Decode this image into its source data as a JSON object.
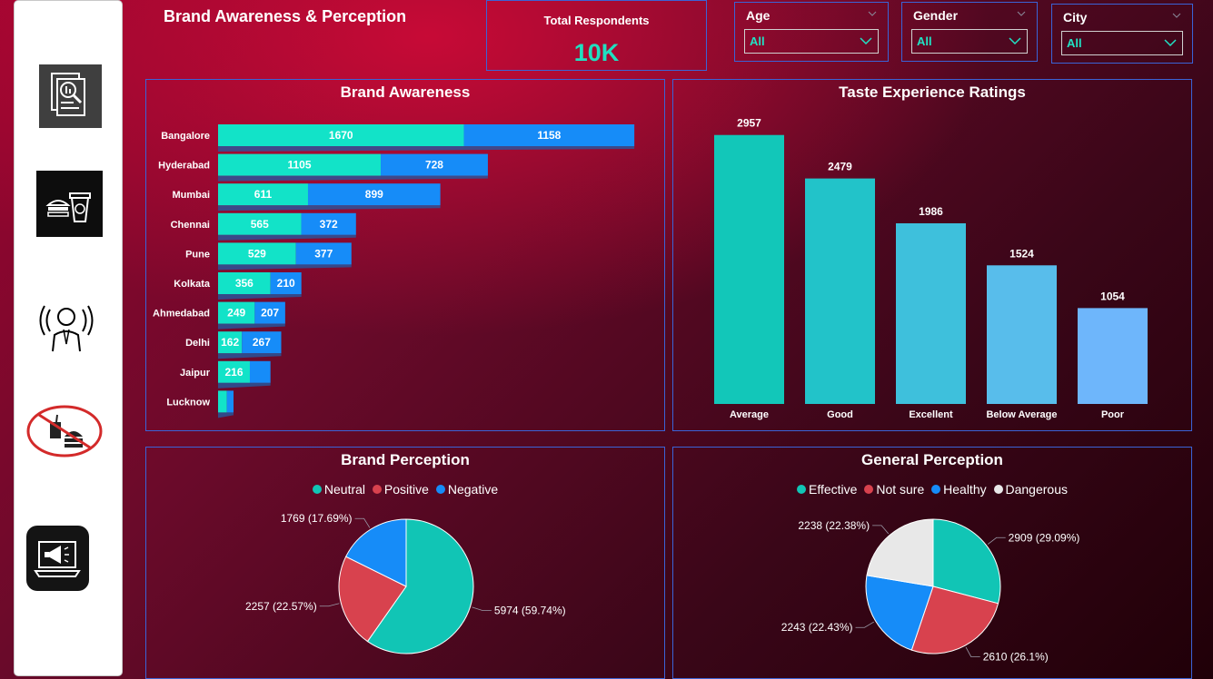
{
  "page_title": "Brand Awareness & Perception",
  "kpi": {
    "label": "Total Respondents",
    "value": "10K"
  },
  "slicers": [
    {
      "label": "Age",
      "value": "All"
    },
    {
      "label": "Gender",
      "value": "All"
    },
    {
      "label": "City",
      "value": "All"
    }
  ],
  "nav_icons": [
    "report-magnifier-icon",
    "food-drink-icon",
    "broadcast-person-icon",
    "no-fast-food-icon",
    "megaphone-laptop-icon"
  ],
  "colors": {
    "teal": "#12e3c8",
    "blue": "#168cf8",
    "neutral": "#11c5b5",
    "positive": "#d8424e",
    "negative": "#168cf8",
    "dangerous": "#e8e8e8",
    "accent_border": "#3b63d6"
  },
  "chart_data": [
    {
      "type": "bar",
      "orientation": "horizontal",
      "stacked": true,
      "title": "Brand Awareness",
      "categories": [
        "Bangalore",
        "Hyderabad",
        "Mumbai",
        "Chennai",
        "Pune",
        "Kolkata",
        "Ahmedabad",
        "Delhi",
        "Jaipur",
        "Lucknow"
      ],
      "series": [
        {
          "color": "#12e3c8",
          "values": [
            1670,
            1105,
            611,
            565,
            529,
            356,
            249,
            162,
            216,
            60
          ]
        },
        {
          "color": "#168cf8",
          "values": [
            1158,
            728,
            899,
            372,
            377,
            210,
            207,
            267,
            140,
            45
          ]
        }
      ],
      "data_labels": [
        [
          "1670",
          "1105",
          "611",
          "565",
          "529",
          "356",
          "249",
          "162",
          "216",
          ""
        ],
        [
          "1158",
          "728",
          "899",
          "372",
          "377",
          "210",
          "207",
          "267",
          "",
          ""
        ]
      ]
    },
    {
      "type": "bar",
      "title": "Taste Experience Ratings",
      "categories": [
        "Average",
        "Good",
        "Excellent",
        "Below Average",
        "Poor"
      ],
      "values": [
        2957,
        2479,
        1986,
        1524,
        1054
      ],
      "colors": [
        "#12c7b9",
        "#22c3c9",
        "#3ec0dc",
        "#58bdeb",
        "#6eb6fb"
      ]
    },
    {
      "type": "pie",
      "title": "Brand Perception",
      "legend": [
        "Neutral",
        "Positive",
        "Negative"
      ],
      "slices": [
        {
          "label": "Neutral",
          "value": 5974,
          "text": "5974 (59.74%)",
          "color": "#11c5b5"
        },
        {
          "label": "Positive",
          "value": 2257,
          "text": "2257 (22.57%)",
          "color": "#d8424e"
        },
        {
          "label": "Negative",
          "value": 1769,
          "text": "1769 (17.69%)",
          "color": "#168cf8"
        }
      ]
    },
    {
      "type": "pie",
      "title": "General Perception",
      "legend": [
        "Effective",
        "Not sure",
        "Healthy",
        "Dangerous"
      ],
      "slices": [
        {
          "label": "Effective",
          "value": 2909,
          "text": "2909 (29.09%)",
          "color": "#11c5b5"
        },
        {
          "label": "Not sure",
          "value": 2610,
          "text": "2610 (26.1%)",
          "color": "#d8424e"
        },
        {
          "label": "Healthy",
          "value": 2243,
          "text": "2243 (22.43%)",
          "color": "#168cf8"
        },
        {
          "label": "Dangerous",
          "value": 2238,
          "text": "2238 (22.38%)",
          "color": "#e8e8e8"
        }
      ]
    }
  ]
}
